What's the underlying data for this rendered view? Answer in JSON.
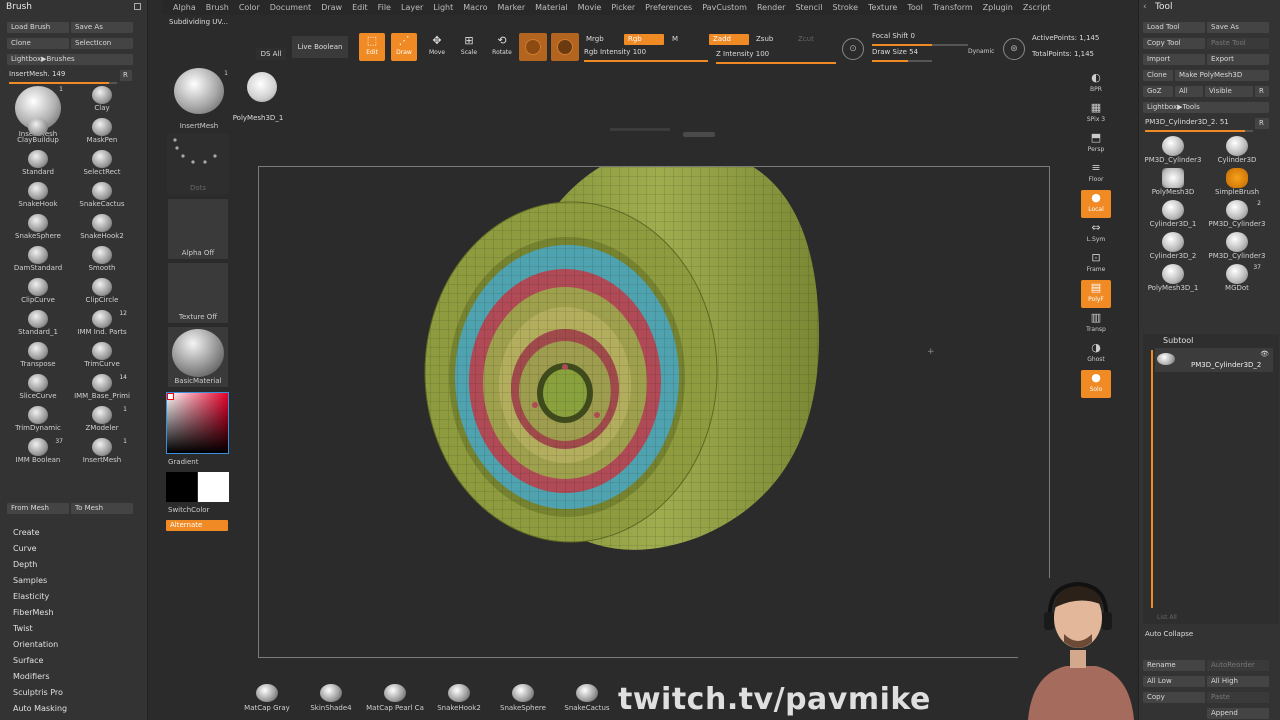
{
  "menu": [
    "Alpha",
    "Brush",
    "Color",
    "Document",
    "Draw",
    "Edit",
    "File",
    "Layer",
    "Light",
    "Macro",
    "Marker",
    "Material",
    "Movie",
    "Picker",
    "Preferences",
    "PavCustom",
    "Render",
    "Stencil",
    "Stroke",
    "Texture",
    "Tool",
    "Transform",
    "Zplugin",
    "Zscript"
  ],
  "status_text": "Subdividing UV...",
  "brush_panel": {
    "title": "Brush",
    "load_brush": "Load Brush",
    "save_as": "Save As",
    "clone": "Clone",
    "select_icon": "SelectIcon",
    "lightbox_brushes": "Lightbox▶Brushes",
    "insert_mesh_slider": "InsertMesh. 149",
    "r_button": "R",
    "brushes": [
      {
        "name": "InsertMesh",
        "count": "1"
      },
      {
        "name": "Clay",
        "count": ""
      },
      {
        "name": "ClayBuildup",
        "count": ""
      },
      {
        "name": "MaskPen",
        "count": ""
      },
      {
        "name": "Standard",
        "count": ""
      },
      {
        "name": "SelectRect",
        "count": ""
      },
      {
        "name": "SnakeHook",
        "count": ""
      },
      {
        "name": "SnakeCactus",
        "count": ""
      },
      {
        "name": "SnakeSphere",
        "count": ""
      },
      {
        "name": "SnakeHook2",
        "count": ""
      },
      {
        "name": "DamStandard",
        "count": ""
      },
      {
        "name": "Smooth",
        "count": ""
      },
      {
        "name": "ClipCurve",
        "count": ""
      },
      {
        "name": "ClipCircle",
        "count": ""
      },
      {
        "name": "Standard_1",
        "count": ""
      },
      {
        "name": "IMM Ind. Parts",
        "count": "12"
      },
      {
        "name": "Transpose",
        "count": ""
      },
      {
        "name": "TrimCurve",
        "count": ""
      },
      {
        "name": "SliceCurve",
        "count": ""
      },
      {
        "name": "IMM_Base_Primi",
        "count": "14"
      },
      {
        "name": "TrimDynamic",
        "count": ""
      },
      {
        "name": "ZModeler",
        "count": "1"
      },
      {
        "name": "IMM Boolean",
        "count": "37"
      },
      {
        "name": "InsertMesh",
        "count": "1"
      }
    ],
    "from_mesh": "From Mesh",
    "to_mesh": "To Mesh",
    "submenus": [
      "Create",
      "Curve",
      "Depth",
      "Samples",
      "Elasticity",
      "FiberMesh",
      "Twist",
      "Orientation",
      "Surface",
      "Modifiers",
      "Sculptris Pro",
      "Auto Masking"
    ]
  },
  "col2": {
    "current_brush": "InsertMesh",
    "current_brush_count": "1",
    "polymesh_label": "PolyMesh3D_1",
    "dots": "Dots",
    "alpha_off": "Alpha Off",
    "texture_off": "Texture Off",
    "material": "BasicMaterial",
    "gradient": "Gradient",
    "switch_color": "SwitchColor",
    "alternate": "Alternate"
  },
  "toolbar": {
    "ds_all": "DS All",
    "live_boolean": "Live Boolean",
    "edit": "Edit",
    "draw": "Draw",
    "move": "Move",
    "scale": "Scale",
    "rotate": "Rotate",
    "mrgb": "Mrgb",
    "rgb": "Rgb",
    "m": "M",
    "zadd": "Zadd",
    "zsub": "Zsub",
    "zcut": "Zcut",
    "rgb_intensity_label": "Rgb Intensity",
    "rgb_intensity": "100",
    "z_intensity_label": "Z Intensity",
    "z_intensity": "100",
    "focal_shift_label": "Focal Shift",
    "focal_shift": "0",
    "draw_size_label": "Draw Size",
    "draw_size": "54",
    "dynamic": "Dynamic",
    "active_points_label": "ActivePoints:",
    "active_points": "1,145",
    "total_points_label": "TotalPoints:",
    "total_points": "1,145"
  },
  "vtools": [
    {
      "label": "BPR",
      "on": false
    },
    {
      "label": "SPix 3",
      "on": false
    },
    {
      "label": "Persp",
      "on": false
    },
    {
      "label": "Floor",
      "on": false
    },
    {
      "label": "Local",
      "on": true
    },
    {
      "label": "L.Sym",
      "on": false
    },
    {
      "label": "Frame",
      "on": false
    },
    {
      "label": "PolyF",
      "on": true
    },
    {
      "label": "Transp",
      "on": false
    },
    {
      "label": "Ghost",
      "on": false
    },
    {
      "label": "Solo",
      "on": true
    }
  ],
  "tool_panel": {
    "title": "Tool",
    "load_tool": "Load Tool",
    "save_as": "Save As",
    "copy_tool": "Copy Tool",
    "paste_tool": "Paste Tool",
    "import": "Import",
    "export": "Export",
    "clone": "Clone",
    "make_polymesh": "Make PolyMesh3D",
    "goz": "GoZ",
    "all": "All",
    "visible": "Visible",
    "r": "R",
    "lightbox_tools": "Lightbox▶Tools",
    "current_tool_slider": "PM3D_Cylinder3D_2. 51",
    "tools": [
      {
        "name": "PM3D_Cylinder3",
        "count": ""
      },
      {
        "name": "Cylinder3D",
        "count": ""
      },
      {
        "name": "PolyMesh3D",
        "count": ""
      },
      {
        "name": "SimpleBrush",
        "count": ""
      },
      {
        "name": "Cylinder3D_1",
        "count": ""
      },
      {
        "name": "PM3D_Cylinder3",
        "count": "2"
      },
      {
        "name": "Cylinder3D_2",
        "count": ""
      },
      {
        "name": "PM3D_Cylinder3",
        "count": ""
      },
      {
        "name": "PolyMesh3D_1",
        "count": ""
      },
      {
        "name": "MGDot",
        "count": "37"
      }
    ],
    "subtool_title": "Subtool",
    "subtool_item": "PM3D_Cylinder3D_2",
    "list_all": "List All",
    "auto_collapse": "Auto Collapse",
    "rename": "Rename",
    "auto_reorder": "AutoReorder",
    "all_low": "All Low",
    "all_high": "All High",
    "copy": "Copy",
    "paste": "Paste",
    "append": "Append"
  },
  "shelf": [
    "MatCap Gray",
    "SkinShade4",
    "MatCap Pearl Ca",
    "SnakeHook2",
    "SnakeSphere",
    "SnakeCactus"
  ],
  "watermark": "twitch.tv/pavmike",
  "colors": {
    "accent": "#f08a24",
    "panel": "#333333",
    "viewport": "#2b2b2b",
    "mesh_green": "#8a9a3c",
    "mesh_cyan": "#4fa3b0",
    "mesh_red": "#b04a56"
  }
}
